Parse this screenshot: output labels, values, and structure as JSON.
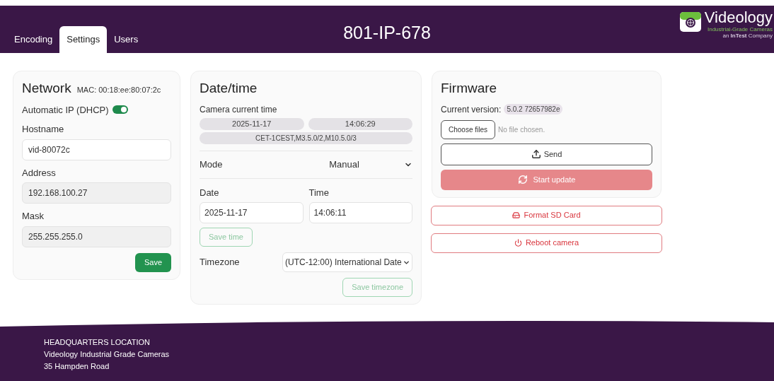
{
  "header": {
    "title": "801-IP-678",
    "tabs": [
      {
        "label": "Encoding",
        "selected": false
      },
      {
        "label": "Settings",
        "selected": true
      },
      {
        "label": "Users",
        "selected": false
      }
    ],
    "logo": {
      "name": "Videology",
      "tagline": "Industrial-Grade Cameras",
      "company": "an **InTest** Company"
    }
  },
  "network": {
    "title": "Network",
    "mac": "MAC: 00:18:ee:80:07:2c",
    "dhcp": {
      "label": "Automatic IP (DHCP)",
      "on": true
    },
    "fields": [
      {
        "label": "Hostname",
        "value": "vid-80072c",
        "disabled": false
      },
      {
        "label": "Address",
        "value": "192.168.100.27",
        "disabled": true
      },
      {
        "label": "Mask",
        "value": "255.255.255.0",
        "disabled": true
      }
    ],
    "save": "Save"
  },
  "datetime": {
    "title": "Date/time",
    "current_label": "Camera current time",
    "current_date": "2025-11-17",
    "current_time": "14:06:29",
    "tz_string": "CET-1CEST,M3.5.0/2,M10.5.0/3",
    "mode": {
      "label": "Mode",
      "value": "Manual"
    },
    "date": {
      "label": "Date",
      "value": "2025-11-17"
    },
    "time": {
      "label": "Time",
      "value": "14:06:11"
    },
    "save_time": {
      "label": "Save time",
      "disabled": true
    },
    "timezone": {
      "label": "Timezone",
      "value": "(UTC-12:00) International Date"
    },
    "save_timezone": {
      "label": "Save timezone",
      "disabled": true
    }
  },
  "firmware": {
    "title": "Firmware",
    "version_label": "Current version:",
    "version": "5.0.2 72657982e",
    "choose": "Choose files",
    "no_file": "No file chosen.",
    "send": "Send",
    "start_update": {
      "label": "Start update",
      "disabled": true
    }
  },
  "actions": [
    {
      "label": "Format SD Card",
      "kind": "format"
    },
    {
      "label": "Reboot camera",
      "kind": "reboot"
    }
  ],
  "footer": {
    "heading": "HEADQUARTERS LOCATION",
    "lines": [
      "Videology Industrial Grade Cameras",
      "35 Hampden Road"
    ]
  }
}
